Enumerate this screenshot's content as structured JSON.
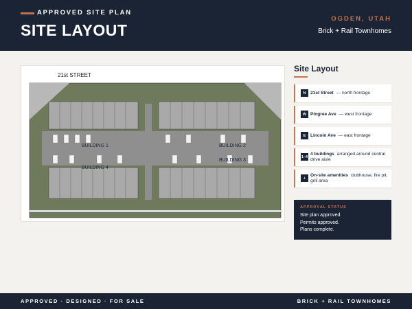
{
  "header": {
    "eyebrow": "APPROVED SITE PLAN",
    "title": "SITE LAYOUT",
    "city": "OGDEN, UTAH",
    "project": "Brick + Rail Townhomes"
  },
  "plan": {
    "street_label": "21st STREET",
    "buildings": [
      "BUILDING 1",
      "BUILDING 2",
      "BUILDING 3",
      "BUILDING 4"
    ]
  },
  "sidebar": {
    "title": "Site Layout",
    "items": [
      {
        "tag": "N",
        "bold": "21st Street",
        "text": "— north frontage"
      },
      {
        "tag": "W",
        "bold": "Pingree Ave",
        "text": "— west frontage"
      },
      {
        "tag": "E",
        "bold": "Lincoln Ave",
        "text": "— east frontage"
      },
      {
        "tag": "1–4",
        "bold": "4 buildings",
        "text": "arranged around central drive aisle"
      },
      {
        "tag": "+",
        "bold": "On-site amenities",
        "text": "clubhouse, fire pit, grill area"
      }
    ],
    "status": {
      "label": "APPROVAL STATUS",
      "lines": [
        "Site plan approved.",
        "Permits approved.",
        "Plans complete."
      ]
    }
  },
  "footer": {
    "left": "APPROVED · DESIGNED · FOR SALE",
    "right": "BRICK + RAIL TOWNHOMES"
  },
  "colors": {
    "navy": "#1b2435",
    "accent": "#c8734a",
    "background": "#f4f2ee"
  }
}
